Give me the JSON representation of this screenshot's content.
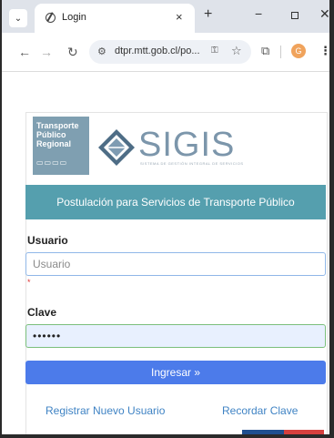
{
  "browser": {
    "tab_title": "Login",
    "tab_close": "×",
    "new_tab": "+",
    "minimize": "−",
    "close": "✕",
    "url": "dtpr.mtt.gob.cl/po...",
    "profile_initial": "G",
    "icons": [
      "tab-menu-icon",
      "globe-icon",
      "back-icon",
      "forward-icon",
      "reload-icon",
      "site-info-icon",
      "password-key-icon",
      "star-icon",
      "extensions-icon",
      "kebab-menu-icon"
    ]
  },
  "logos": {
    "tpr_lines": [
      "Transporte",
      "Público",
      "Regional"
    ],
    "sigis_name": "SIGIS",
    "sigis_subtitle": "SISTEMA DE GESTIÓN INTEGRAL DE SERVICIOS"
  },
  "banner": {
    "text": "Postulación para Servicios de Transporte Público"
  },
  "form": {
    "usuario_label": "Usuario",
    "usuario_placeholder": "Usuario",
    "required_mark": "*",
    "clave_label": "Clave",
    "clave_value": "••••••",
    "login_button": "Ingresar »"
  },
  "links": {
    "register": "Registrar Nuevo Usuario",
    "recover": "Recordar Clave"
  },
  "colors": {
    "banner": "#559fae",
    "button": "#4c7bea",
    "link": "#3f83c4",
    "logo_box": "#7f9fb1"
  }
}
